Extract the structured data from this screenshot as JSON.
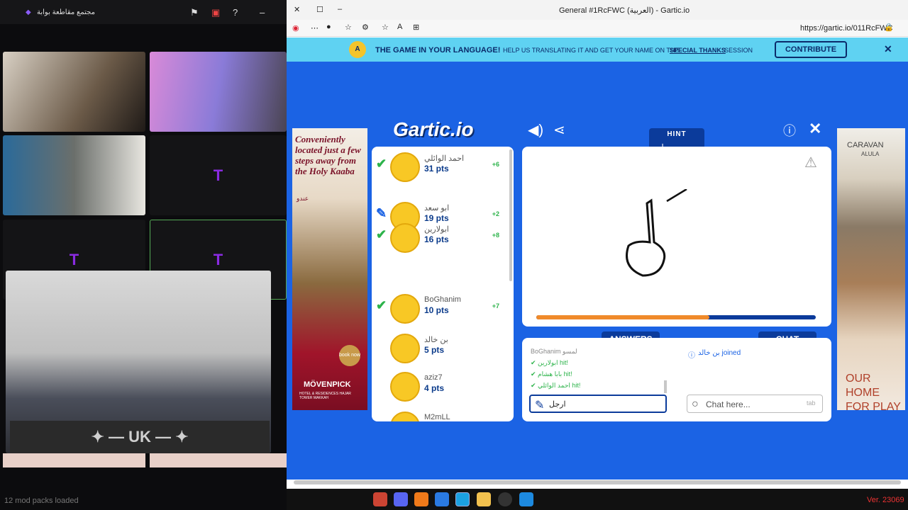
{
  "stream": {
    "top_title": "مجتمع مقاطعة بوابة",
    "footer": "12 mod packs loaded",
    "overlay_logo": "✦ — UK — ✦"
  },
  "browser": {
    "tab_title": "General #1RcFWC (العربية) - Gartic.io",
    "url": "https://gartic.io/011RcFWC"
  },
  "banner": {
    "headline": "THE GAME IN YOUR LANGUAGE!",
    "text": "HELP US TRANSLATING IT AND GET YOUR NAME ON THE",
    "link": "SPECIAL THANKS",
    "tail": "SESSION",
    "button": "CONTRIBUTE"
  },
  "game": {
    "logo": "Gartic.io",
    "hint_label": "HINT",
    "hint_value": "ا _ _ _ _",
    "progress": 0.62,
    "players": [
      {
        "name": "احمد الوائلي",
        "pts": "31 pts",
        "delta": "+6",
        "status": "check"
      },
      {
        "name": "ابو سعد",
        "pts": "19 pts",
        "delta": "+2",
        "status": "drawing"
      },
      {
        "name": "ابولارين",
        "pts": "16 pts",
        "delta": "+8",
        "status": "check"
      },
      {
        "name": "BoGhanim",
        "pts": "10 pts",
        "delta": "+7",
        "status": "check"
      },
      {
        "name": "بن خالد",
        "pts": "5 pts",
        "delta": "",
        "status": ""
      },
      {
        "name": "aziz7",
        "pts": "4 pts",
        "delta": "",
        "status": ""
      },
      {
        "name": "M2mLL",
        "pts": "",
        "delta": "",
        "status": ""
      }
    ],
    "answers_tab": "ANSWERS",
    "chat_tab": "CHAT",
    "answers": [
      {
        "text": "BoGhanim لمسو",
        "type": "plain"
      },
      {
        "text": "ابولارين hit!",
        "type": "hit"
      },
      {
        "text": "بابا هشام hit!",
        "type": "hit"
      },
      {
        "text": "احمد الوائلي hit!",
        "type": "hit"
      }
    ],
    "answer_input_value": "ارجل",
    "chat_message": "بن خالد joined",
    "chat_placeholder": "Chat here...",
    "chat_key": "tab"
  },
  "ads": {
    "left_text": "Conveniently located just a few steps away from the Holy Kaaba",
    "left_sub": "عندو",
    "left_brand": "MÖVENPICK",
    "left_brand_sub": "HOTEL & RESIDENCES HAJAR TOWER MAKKAH",
    "left_cta": "book now",
    "right_brand": "CARAVAN",
    "right_brand_sub": "ALULA",
    "right_text": "OUR HOME FOR PLAY"
  },
  "taskbar": {
    "version": "Ver. 23069"
  }
}
